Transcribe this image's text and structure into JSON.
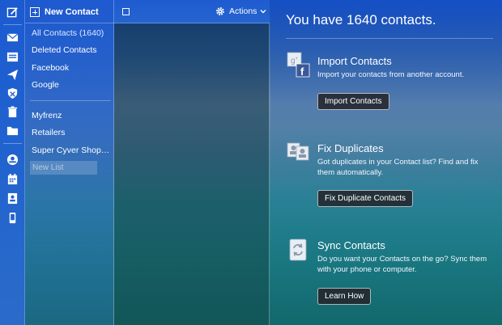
{
  "rail": {
    "icons": [
      "compose-icon",
      "mail-icon",
      "inbox-icon",
      "send-icon",
      "shield-icon",
      "trash-icon",
      "folder-icon",
      "contacts-icon",
      "calendar-icon",
      "address-book-icon",
      "mobile-icon"
    ]
  },
  "folders": {
    "new_contact_label": "New Contact",
    "items": [
      {
        "label": "All Contacts (1640)"
      },
      {
        "label": "Deleted Contacts"
      },
      {
        "label": "Facebook"
      },
      {
        "label": "Google"
      }
    ],
    "lists": [
      {
        "label": "Myfrenz"
      },
      {
        "label": "Retailers"
      },
      {
        "label": "Super Cyver Shop Cl..."
      }
    ],
    "new_list_placeholder": "New List"
  },
  "list": {
    "actions_label": "Actions"
  },
  "main": {
    "title": "You have 1640 contacts.",
    "sections": [
      {
        "title": "Import Contacts",
        "description": "Import your contacts from another account.",
        "button": "Import Contacts",
        "icon": "import-icon"
      },
      {
        "title": "Fix Duplicates",
        "description": "Got duplicates in your Contact list? Find and fix them automatically.",
        "button": "Fix Duplicate Contacts",
        "icon": "duplicates-icon"
      },
      {
        "title": "Sync Contacts",
        "description": "Do you want your Contacts on the go? Sync them with your phone or computer.",
        "button": "Learn How",
        "icon": "sync-icon"
      }
    ]
  }
}
